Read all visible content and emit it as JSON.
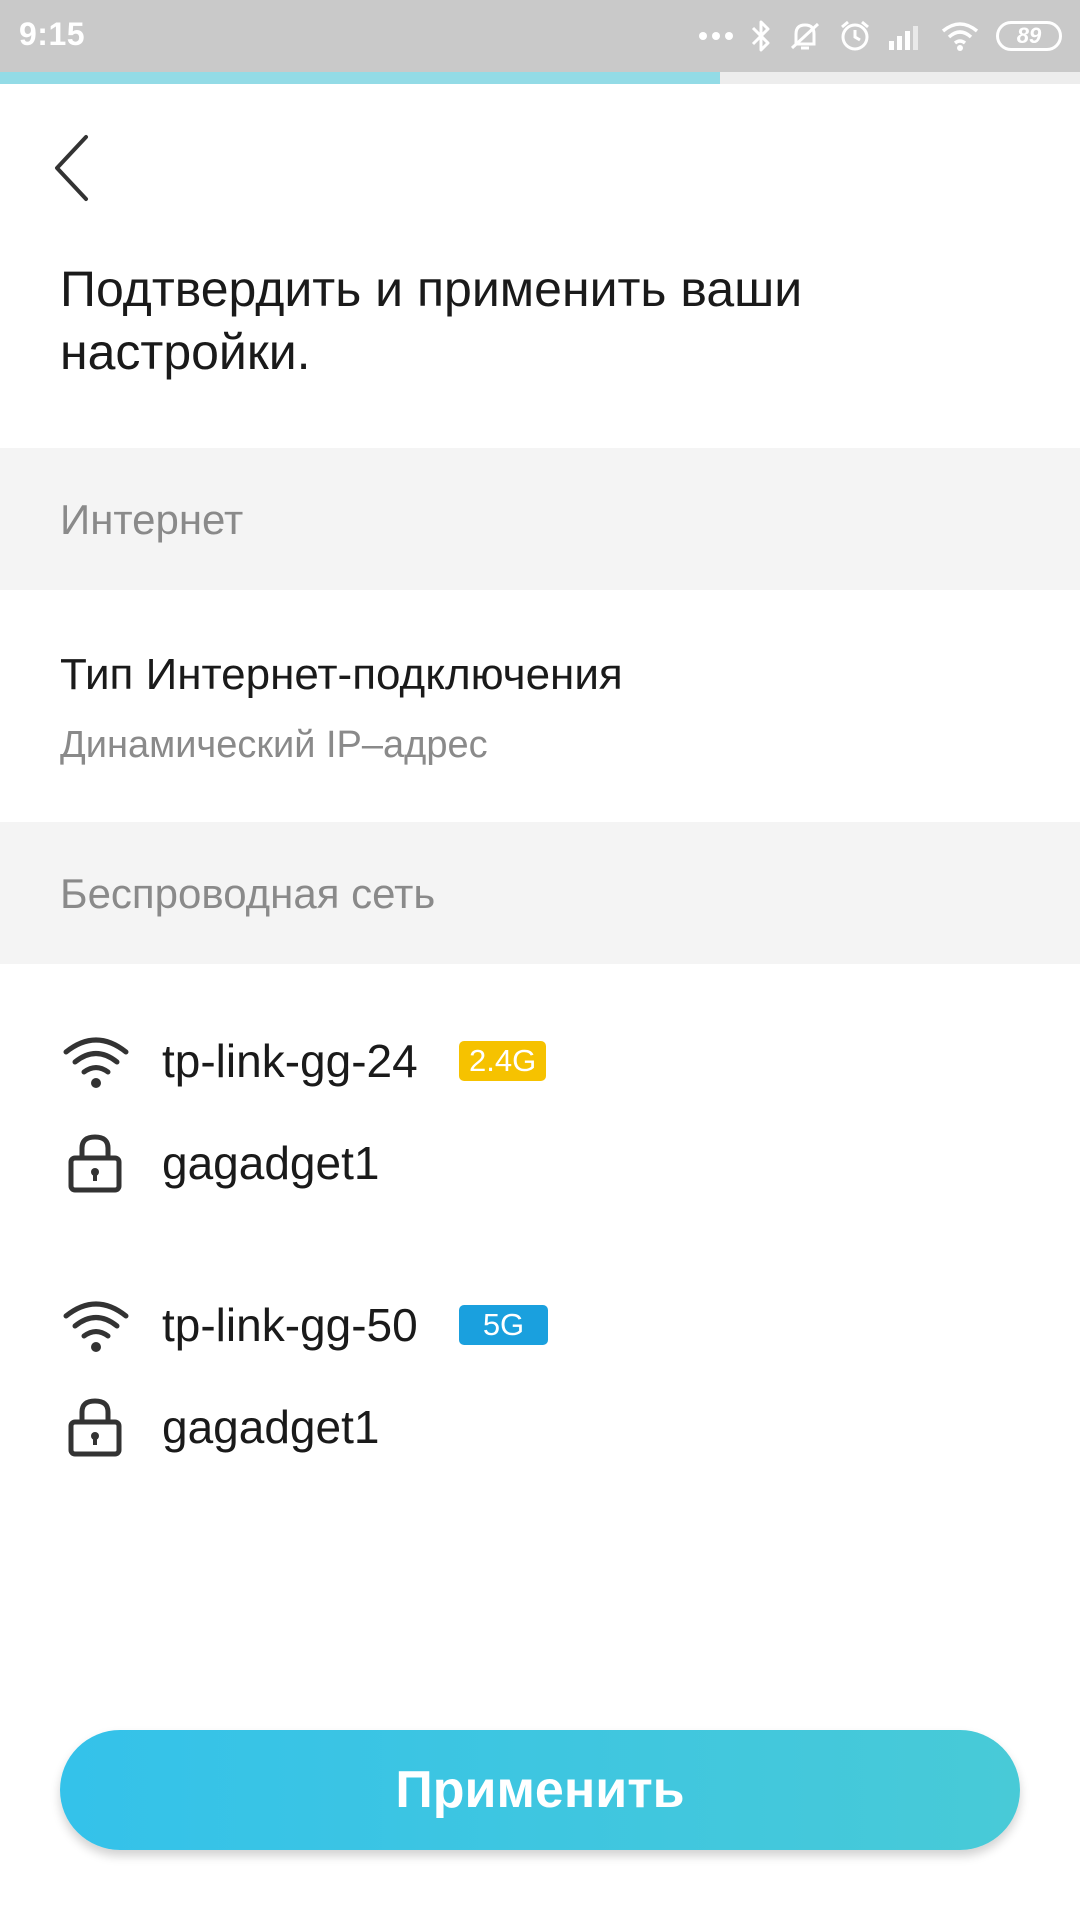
{
  "status_bar": {
    "time": "9:15",
    "battery": "89",
    "icons": [
      "more-dots-icon",
      "bluetooth-icon",
      "notifications-off-icon",
      "alarm-icon",
      "signal-icon",
      "wifi-icon",
      "battery-icon"
    ]
  },
  "progress": {
    "fraction": 0.667,
    "fill_color": "#93dbe6"
  },
  "header": {
    "back_icon": "chevron-left-icon",
    "title": "Подтвердить и применить ваши настройки."
  },
  "internet": {
    "section_label": "Интернет",
    "connection_type_label": "Тип Интернет-подключения",
    "connection_type_value": "Динамический IP–адрес"
  },
  "wireless": {
    "section_label": "Беспроводная сеть",
    "networks": [
      {
        "ssid": "tp-link-gg-24",
        "band": "2.4G",
        "band_color": "#f6c200",
        "password": "gagadget1"
      },
      {
        "ssid": "tp-link-gg-50",
        "band": "5G",
        "band_color": "#1aa0de",
        "password": "gagadget1"
      }
    ]
  },
  "actions": {
    "apply_label": "Применить"
  },
  "colors": {
    "accent": "#34c2ea",
    "section_bg": "#f4f4f4"
  }
}
